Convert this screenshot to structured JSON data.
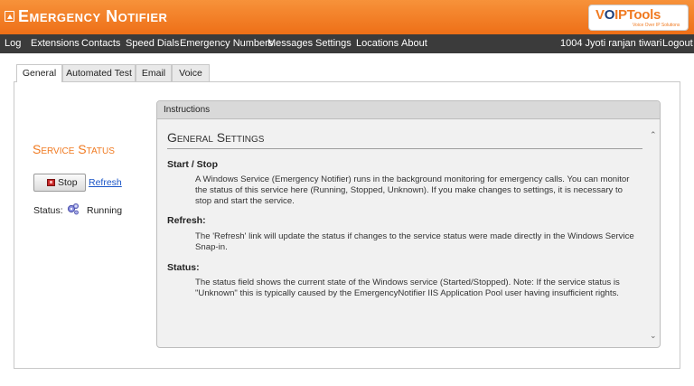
{
  "app": {
    "title": "Emergency Notifier",
    "logo": {
      "part1": "V",
      "part2": "O",
      "part3": "IPTools",
      "tagline": "Voice Over IP Solutions"
    }
  },
  "nav": {
    "items": [
      "Log",
      "Extensions",
      "Contacts",
      "Speed Dials",
      "Emergency Numbers",
      "Messages",
      "Settings",
      "Locations",
      "About"
    ],
    "user": "1004  Jyoti ranjan tiwari",
    "logout": "Logout"
  },
  "tabs": [
    "General",
    "Automated Test",
    "Email",
    "Voice"
  ],
  "service": {
    "title": "Service Status",
    "stop_label": "Stop",
    "refresh_label": "Refresh",
    "status_label": "Status:",
    "status_value": "Running"
  },
  "instructions": {
    "header": "Instructions",
    "title": "General Settings",
    "sections": [
      {
        "heading": "Start / Stop",
        "text": "A Windows Service (Emergency Notifier) runs in the background monitoring for emergency calls. You can monitor the status of this service here (Running, Stopped, Unknown). If you make changes to settings, it is necessary to stop and start the service."
      },
      {
        "heading": "Refresh:",
        "text": "The 'Refresh' link will update the status if changes to the service status were made directly in the Windows Service Snap-in."
      },
      {
        "heading": "Status:",
        "text": "The status field shows the current state of the Windows service (Started/Stopped). Note: If the service status is \"Unknown\" this is typically caused by the EmergencyNotifier IIS Application Pool user having insufficient rights."
      }
    ]
  },
  "colors": {
    "header": "#f07a21",
    "nav": "#3b3b3b",
    "accent": "#f07a21",
    "link": "#1a55c7"
  }
}
